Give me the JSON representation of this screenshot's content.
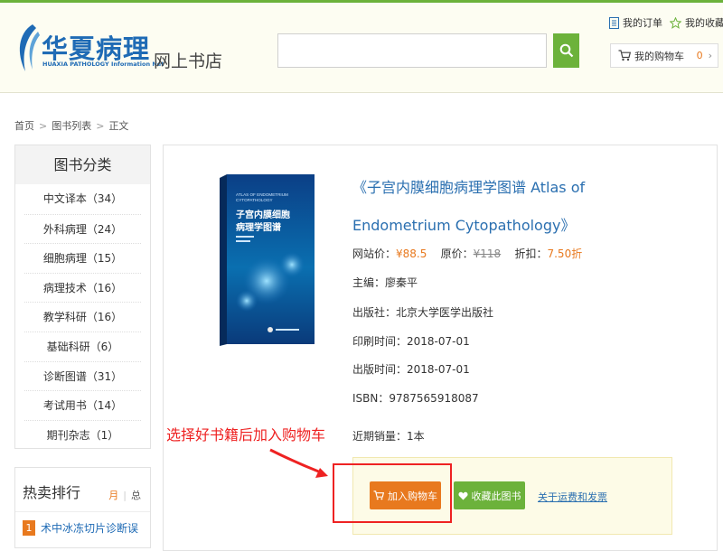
{
  "header": {
    "logo_cn": "华夏病理",
    "logo_en": "HUAXIA PATHOLOGY Information Net",
    "store_name": "网上书店",
    "search_placeholder": "",
    "orders_label": "我的订单",
    "favorites_label": "我的收藏",
    "cart_label": "我的购物车",
    "cart_count": "0"
  },
  "breadcrumb": [
    "首页",
    "图书列表",
    "正文"
  ],
  "breadcrumb_sep": ">",
  "sidebar": {
    "title": "图书分类",
    "items": [
      {
        "label": "中文译本（34）"
      },
      {
        "label": "外科病理（24）"
      },
      {
        "label": "细胞病理（15）"
      },
      {
        "label": "病理技术（16）"
      },
      {
        "label": "教学科研（16）"
      },
      {
        "label": "基础科研（6）"
      },
      {
        "label": "诊断图谱（31）"
      },
      {
        "label": "考试用书（14）"
      },
      {
        "label": "期刊杂志（1）"
      }
    ]
  },
  "hot": {
    "title": "热卖排行",
    "tab_month": "月",
    "tab_divider": "|",
    "tab_total": "总",
    "rank": "1",
    "book": "术中冰冻切片诊断误"
  },
  "book": {
    "title": "《子宫内膜细胞病理学图谱 Atlas of Endometrium Cytopathology》",
    "cover_en": "ATLAS OF ENDOMETRIUM CYTOPATHOLOGY",
    "cover_cn1": "子宫内膜细胞",
    "cover_cn2": "病理学图谱",
    "price_site_label": "网站价：",
    "price_site": "¥88.5",
    "price_orig_label": "原价：",
    "price_orig": "¥118",
    "discount_label": "折扣：",
    "discount": "7.50折",
    "editor_label": "主编：",
    "editor": "廖秦平",
    "publisher_label": "出版社：",
    "publisher": "北京大学医学出版社",
    "print_label": "印刷时间：",
    "print_date": "2018-07-01",
    "pub_label": "出版时间：",
    "pub_date": "2018-07-01",
    "isbn_label": "ISBN：",
    "isbn": "9787565918087",
    "sales_label": "近期销量：",
    "sales": "1本"
  },
  "actions": {
    "add_cart": "加入购物车",
    "favorite": "收藏此图书",
    "shipping": "关于运费和发票"
  },
  "annotation": "选择好书籍后加入购物车",
  "colors": {
    "brand_blue": "#1f6bb5",
    "accent_green": "#6cb23b",
    "accent_orange": "#e8791e",
    "annotation_red": "#ee2222"
  }
}
